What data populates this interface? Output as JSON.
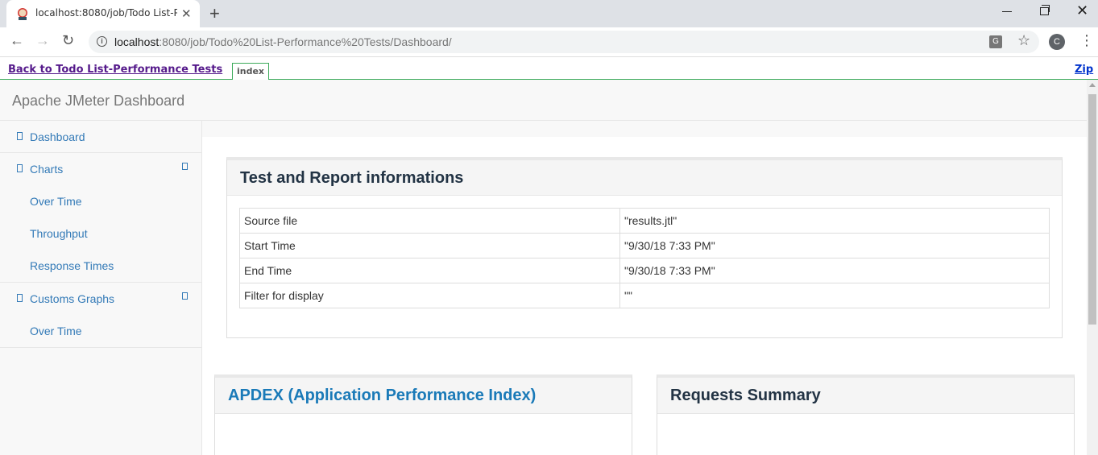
{
  "browser": {
    "tab_title": "localhost:8080/job/Todo List-Perf",
    "newtab_label": "+",
    "close_label": "✕",
    "url_host": "localhost",
    "url_rest": ":8080/job/Todo%20List-Performance%20Tests/Dashboard/",
    "avatar_letter": "C"
  },
  "jenkins": {
    "back_label": "Back to Todo List-Performance Tests",
    "index_tab": "index",
    "zip_label": "Zip"
  },
  "dashboard": {
    "brand": "Apache JMeter Dashboard",
    "nav": {
      "dashboard": "Dashboard",
      "charts": "Charts",
      "charts_items": [
        "Over Time",
        "Throughput",
        "Response Times"
      ],
      "customs": "Customs Graphs",
      "customs_items": [
        "Over Time"
      ]
    },
    "test_info": {
      "title": "Test and Report informations",
      "rows": [
        {
          "key": "Source file",
          "value": "\"results.jtl\""
        },
        {
          "key": "Start Time",
          "value": "\"9/30/18 7:33 PM\""
        },
        {
          "key": "End Time",
          "value": "\"9/30/18 7:33 PM\""
        },
        {
          "key": "Filter for display",
          "value": "\"\""
        }
      ]
    },
    "apdex_title": "APDEX (Application Performance Index)",
    "requests_title": "Requests Summary"
  },
  "colors": {
    "link": "#337ab7",
    "jenkins_green": "#3caa5a",
    "visited": "#551a8b"
  }
}
